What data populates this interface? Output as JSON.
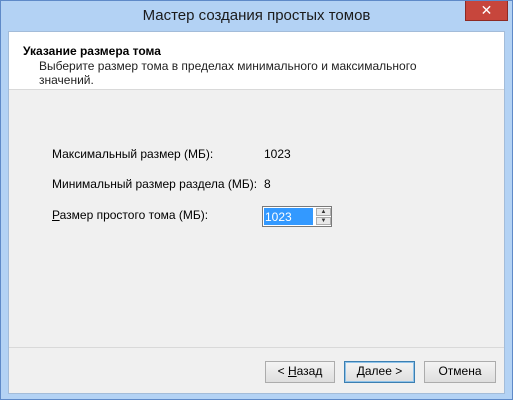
{
  "window": {
    "title": "Мастер создания простых томов",
    "close_glyph": "✕"
  },
  "header": {
    "title": "Указание размера тома",
    "subtitle": "Выберите размер тома в пределах минимального и максимального значений."
  },
  "fields": {
    "max_label": "Максимальный размер (МБ):",
    "max_value": "1023",
    "min_label": "Минимальный размер раздела (МБ):",
    "min_value": "8",
    "size_label_accel": "Р",
    "size_label_rest": "азмер простого тома (МБ):",
    "size_value": "1023",
    "spin_up_glyph": "▲",
    "spin_down_glyph": "▼"
  },
  "buttons": {
    "back_prefix": "< ",
    "back_accel": "Н",
    "back_rest": "азад",
    "next_accel": "Д",
    "next_rest": "алее >",
    "cancel": "Отмена"
  },
  "colors": {
    "title_bar": "#b3d2f4",
    "close_button": "#c7463c",
    "selection": "#3399ff"
  }
}
